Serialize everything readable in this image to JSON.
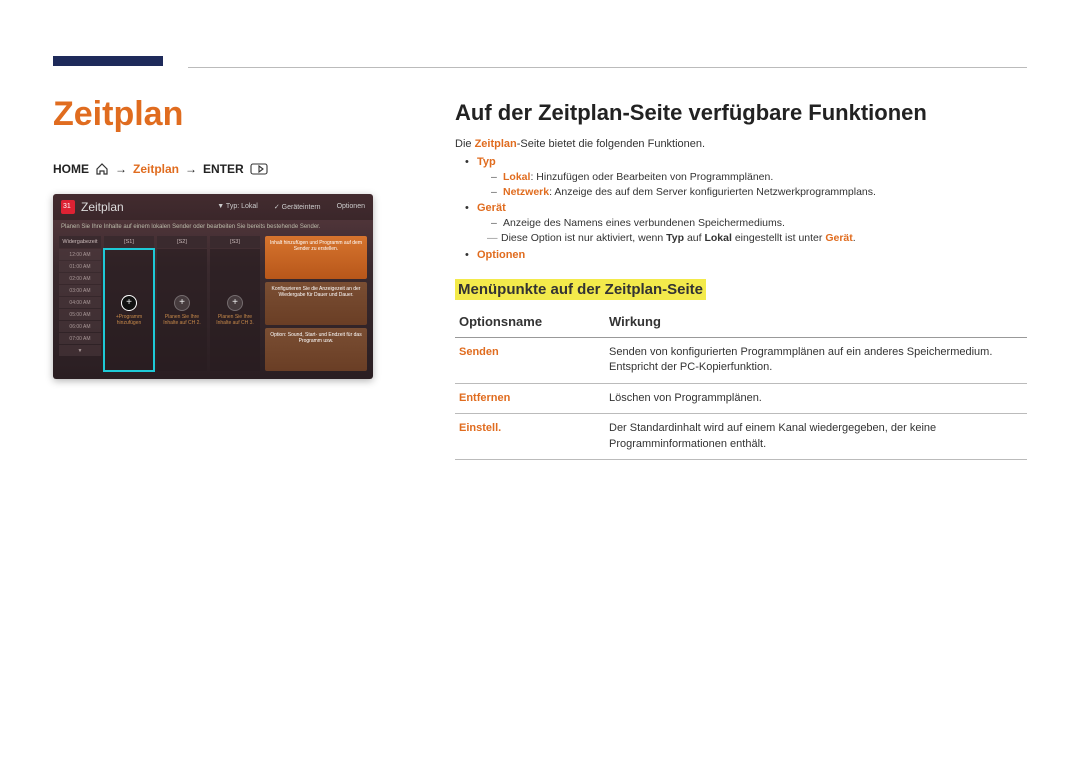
{
  "page": {
    "title": "Zeitplan"
  },
  "breadcrumb": {
    "home": "HOME",
    "sep": "→",
    "zeitplan": "Zeitplan",
    "enter": "ENTER"
  },
  "screenshot": {
    "title": "Zeitplan",
    "tabs": [
      "▼  Typ: Lokal",
      "✓  Geräteintern",
      "Optionen"
    ],
    "subtitle": "Planen Sie Ihre Inhalte auf einem lokalen Sender oder bearbeiten Sie bereits bestehende Sender.",
    "times_header": "Widergabezeit",
    "times": [
      "12:00 AM",
      "01:00 AM",
      "02:00 AM",
      "03:00 AM",
      "04:00 AM",
      "05:00 AM",
      "06:00 AM",
      "07:00 AM",
      "▼"
    ],
    "channels": [
      {
        "name": "[S1]",
        "label": "+Programm hinzufügen",
        "active": true
      },
      {
        "name": "[S2]",
        "label": "Planen Sie Ihre Inhalte auf CH 2.",
        "active": false
      },
      {
        "name": "[S3]",
        "label": "Planen Sie Ihre Inhalte auf CH 3.",
        "active": false
      }
    ],
    "side_panels": [
      "Inhalt hinzufügen und Programm auf dem Sender zu erstellen.",
      "Konfigurieren Sie die Anzeigezeit an der Wiedergabe für Dauer und Dauer.",
      "Option: Sound, Start- und Endzeit für das Programm usw."
    ]
  },
  "right": {
    "h1": "Auf der Zeitplan-Seite verfügbare Funktionen",
    "intro_pre": "Die ",
    "intro_bold": "Zeitplan",
    "intro_post": "-Seite bietet die folgenden Funktionen.",
    "bullets": {
      "typ": {
        "label": "Typ",
        "items": [
          {
            "bold": "Lokal",
            "text": ": Hinzufügen oder Bearbeiten von Programmplänen."
          },
          {
            "bold": "Netzwerk",
            "text": ": Anzeige des auf dem Server konfigurierten Netzwerkprogrammplans."
          }
        ]
      },
      "geraet": {
        "label": "Gerät",
        "items": [
          {
            "bold": "",
            "text": "Anzeige des Namens eines verbundenen Speichermediums."
          }
        ],
        "note_pre": "Diese Option ist nur aktiviert, wenn ",
        "note_b1": "Typ",
        "note_mid": " auf ",
        "note_b2": "Lokal",
        "note_mid2": " eingestellt ist unter ",
        "note_b3": "Gerät",
        "note_end": "."
      },
      "optionen": {
        "label": "Optionen"
      }
    },
    "h2": "Menüpunkte auf der Zeitplan-Seite",
    "table": {
      "col1": "Optionsname",
      "col2": "Wirkung",
      "rows": [
        {
          "name": "Senden",
          "desc": "Senden von konfigurierten Programmplänen auf ein anderes Speichermedium. Entspricht der PC-Kopierfunktion."
        },
        {
          "name": "Entfernen",
          "desc": "Löschen von Programmplänen."
        },
        {
          "name": "Einstell.",
          "desc": "Der Standardinhalt wird auf einem Kanal wiedergegeben, der keine Programminformationen enthält."
        }
      ]
    }
  }
}
